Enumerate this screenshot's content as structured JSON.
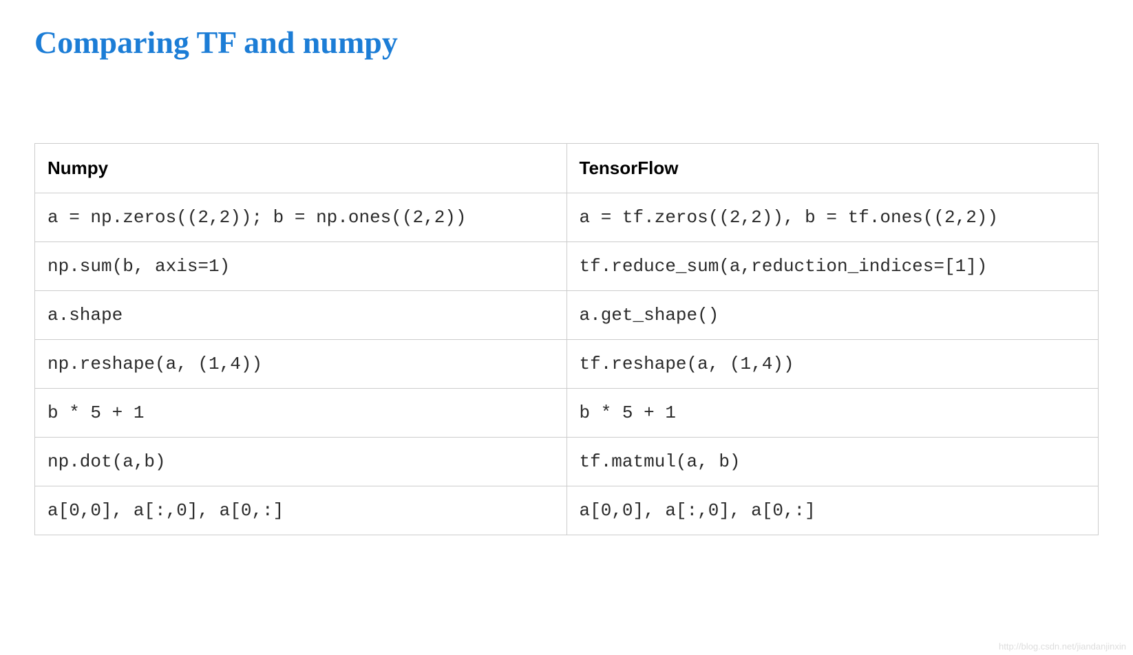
{
  "title": "Comparing TF and numpy",
  "headers": {
    "left": "Numpy",
    "right": "TensorFlow"
  },
  "rows": [
    {
      "numpy": "a = np.zeros((2,2)); b = np.ones((2,2))",
      "tf": "a = tf.zeros((2,2)), b = tf.ones((2,2))"
    },
    {
      "numpy": "np.sum(b, axis=1)",
      "tf": "tf.reduce_sum(a,reduction_indices=[1])"
    },
    {
      "numpy": "a.shape",
      "tf": "a.get_shape()"
    },
    {
      "numpy": "np.reshape(a, (1,4))",
      "tf": "tf.reshape(a, (1,4))"
    },
    {
      "numpy": "b * 5 + 1",
      "tf": "b * 5 + 1"
    },
    {
      "numpy": "np.dot(a,b)",
      "tf": "tf.matmul(a, b)"
    },
    {
      "numpy": "a[0,0], a[:,0], a[0,:]",
      "tf": "a[0,0], a[:,0], a[0,:]"
    }
  ],
  "watermark": "http://blog.csdn.net/jiandanjinxin"
}
